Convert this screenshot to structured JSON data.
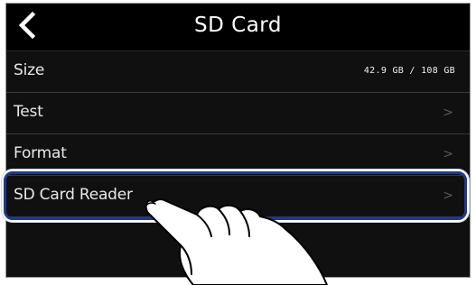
{
  "header": {
    "title": "SD Card",
    "back_icon": "chevron-left-icon"
  },
  "rows": [
    {
      "label": "Size",
      "value": "42.9 GB /  108 GB"
    },
    {
      "label": "Test",
      "chevron": ">"
    },
    {
      "label": "Format",
      "chevron": ">"
    },
    {
      "label": "SD Card Reader",
      "chevron": ">"
    }
  ],
  "colors": {
    "screen_bg": "#101010",
    "header_bg": "#000000",
    "highlight": "#1f3a8a"
  }
}
